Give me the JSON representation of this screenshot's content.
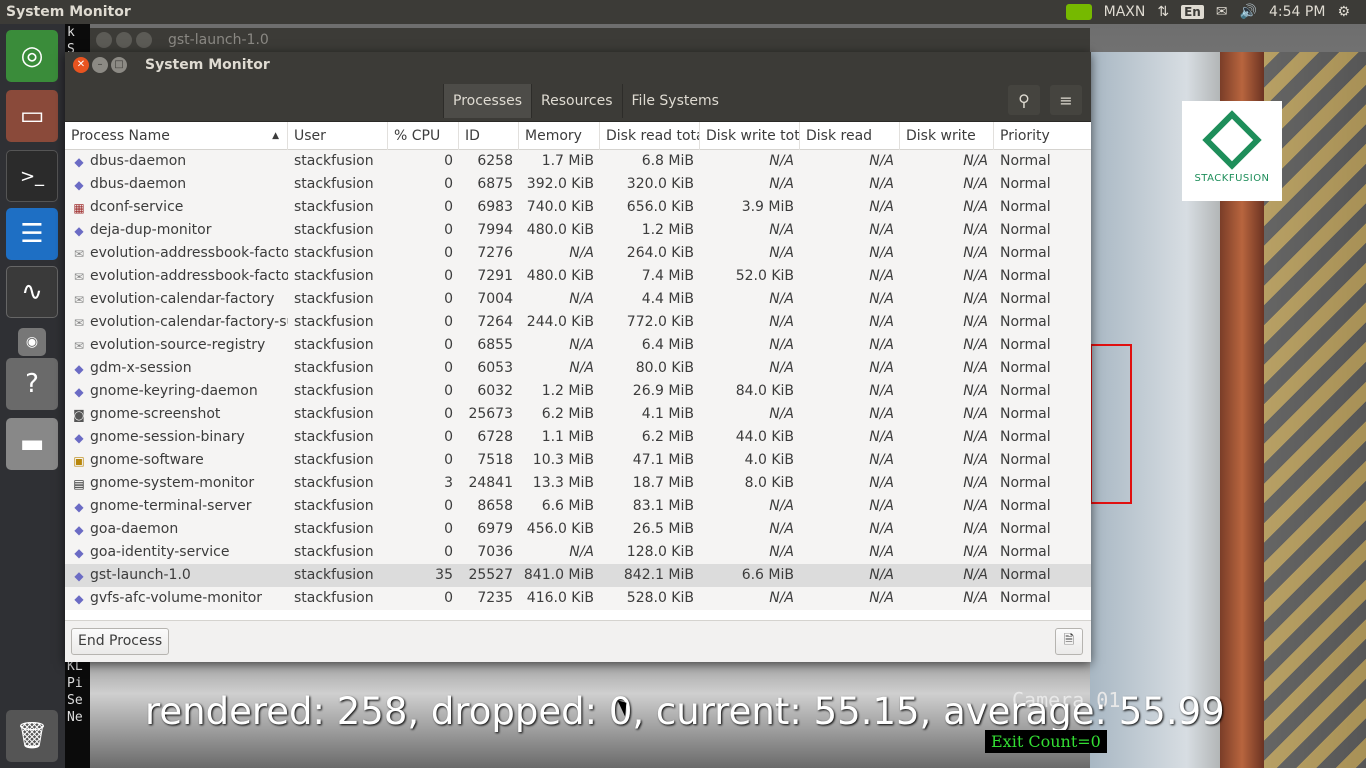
{
  "topbar": {
    "title": "System Monitor",
    "tray": {
      "power_mode": "MAXN",
      "keyboard": "En",
      "clock": "4:54 PM"
    }
  },
  "launcher": {
    "items": [
      "ubuntu-dash",
      "files",
      "terminal",
      "text-editor",
      "system-monitor",
      "screenshot",
      "help",
      "disks",
      "trash"
    ]
  },
  "background_terminal": {
    "lines_top": [
      "k",
      "S"
    ],
    "lines_bottom": [
      "KL",
      "Pi",
      "Se",
      "Ne"
    ]
  },
  "background_window": {
    "title": "gst-launch-1.0"
  },
  "video": {
    "osd_text": "rendered: 258, dropped: 0, current: 55.15, average: 55.99",
    "camera_label": "Camera 01",
    "exit_count": "Exit Count=0",
    "logo_text": "STACKFUSION"
  },
  "window": {
    "title": "System Monitor",
    "tabs": [
      {
        "label": "Processes",
        "active": true
      },
      {
        "label": "Resources",
        "active": false
      },
      {
        "label": "File Systems",
        "active": false
      }
    ],
    "columns": [
      "Process Name",
      "User",
      "% CPU",
      "ID",
      "Memory",
      "Disk read total",
      "Disk write total",
      "Disk read",
      "Disk write",
      "Priority"
    ],
    "rows": [
      {
        "icon": "diamond-icon",
        "name": "dbus-daemon",
        "user": "stackfusion",
        "cpu": "0",
        "id": "6258",
        "memory": "1.7 MiB",
        "disk_read_total": "6.8 MiB",
        "disk_write_total": "N/A",
        "disk_read": "N/A",
        "disk_write": "N/A",
        "priority": "Normal"
      },
      {
        "icon": "diamond-icon",
        "name": "dbus-daemon",
        "user": "stackfusion",
        "cpu": "0",
        "id": "6875",
        "memory": "392.0 KiB",
        "disk_read_total": "320.0 KiB",
        "disk_write_total": "N/A",
        "disk_read": "N/A",
        "disk_write": "N/A",
        "priority": "Normal"
      },
      {
        "icon": "dconf-icon",
        "name": "dconf-service",
        "user": "stackfusion",
        "cpu": "0",
        "id": "6983",
        "memory": "740.0 KiB",
        "disk_read_total": "656.0 KiB",
        "disk_write_total": "3.9 MiB",
        "disk_read": "N/A",
        "disk_write": "N/A",
        "priority": "Normal"
      },
      {
        "icon": "diamond-icon",
        "name": "deja-dup-monitor",
        "user": "stackfusion",
        "cpu": "0",
        "id": "7994",
        "memory": "480.0 KiB",
        "disk_read_total": "1.2 MiB",
        "disk_write_total": "N/A",
        "disk_read": "N/A",
        "disk_write": "N/A",
        "priority": "Normal"
      },
      {
        "icon": "envelope-icon",
        "name": "evolution-addressbook-factory",
        "user": "stackfusion",
        "cpu": "0",
        "id": "7276",
        "memory": "N/A",
        "disk_read_total": "264.0 KiB",
        "disk_write_total": "N/A",
        "disk_read": "N/A",
        "disk_write": "N/A",
        "priority": "Normal"
      },
      {
        "icon": "envelope-icon",
        "name": "evolution-addressbook-factory",
        "user": "stackfusion",
        "cpu": "0",
        "id": "7291",
        "memory": "480.0 KiB",
        "disk_read_total": "7.4 MiB",
        "disk_write_total": "52.0 KiB",
        "disk_read": "N/A",
        "disk_write": "N/A",
        "priority": "Normal"
      },
      {
        "icon": "envelope-icon",
        "name": "evolution-calendar-factory",
        "user": "stackfusion",
        "cpu": "0",
        "id": "7004",
        "memory": "N/A",
        "disk_read_total": "4.4 MiB",
        "disk_write_total": "N/A",
        "disk_read": "N/A",
        "disk_write": "N/A",
        "priority": "Normal"
      },
      {
        "icon": "envelope-icon",
        "name": "evolution-calendar-factory-subprocess",
        "user": "stackfusion",
        "cpu": "0",
        "id": "7264",
        "memory": "244.0 KiB",
        "disk_read_total": "772.0 KiB",
        "disk_write_total": "N/A",
        "disk_read": "N/A",
        "disk_write": "N/A",
        "priority": "Normal"
      },
      {
        "icon": "envelope-icon",
        "name": "evolution-source-registry",
        "user": "stackfusion",
        "cpu": "0",
        "id": "6855",
        "memory": "N/A",
        "disk_read_total": "6.4 MiB",
        "disk_write_total": "N/A",
        "disk_read": "N/A",
        "disk_write": "N/A",
        "priority": "Normal"
      },
      {
        "icon": "diamond-icon",
        "name": "gdm-x-session",
        "user": "stackfusion",
        "cpu": "0",
        "id": "6053",
        "memory": "N/A",
        "disk_read_total": "80.0 KiB",
        "disk_write_total": "N/A",
        "disk_read": "N/A",
        "disk_write": "N/A",
        "priority": "Normal"
      },
      {
        "icon": "diamond-icon",
        "name": "gnome-keyring-daemon",
        "user": "stackfusion",
        "cpu": "0",
        "id": "6032",
        "memory": "1.2 MiB",
        "disk_read_total": "26.9 MiB",
        "disk_write_total": "84.0 KiB",
        "disk_read": "N/A",
        "disk_write": "N/A",
        "priority": "Normal"
      },
      {
        "icon": "camera-icon",
        "name": "gnome-screenshot",
        "user": "stackfusion",
        "cpu": "0",
        "id": "25673",
        "memory": "6.2 MiB",
        "disk_read_total": "4.1 MiB",
        "disk_write_total": "N/A",
        "disk_read": "N/A",
        "disk_write": "N/A",
        "priority": "Normal"
      },
      {
        "icon": "diamond-icon",
        "name": "gnome-session-binary",
        "user": "stackfusion",
        "cpu": "0",
        "id": "6728",
        "memory": "1.1 MiB",
        "disk_read_total": "6.2 MiB",
        "disk_write_total": "44.0 KiB",
        "disk_read": "N/A",
        "disk_write": "N/A",
        "priority": "Normal"
      },
      {
        "icon": "bag-icon",
        "name": "gnome-software",
        "user": "stackfusion",
        "cpu": "0",
        "id": "7518",
        "memory": "10.3 MiB",
        "disk_read_total": "47.1 MiB",
        "disk_write_total": "4.0 KiB",
        "disk_read": "N/A",
        "disk_write": "N/A",
        "priority": "Normal"
      },
      {
        "icon": "monitor-icon",
        "name": "gnome-system-monitor",
        "user": "stackfusion",
        "cpu": "3",
        "id": "24841",
        "memory": "13.3 MiB",
        "disk_read_total": "18.7 MiB",
        "disk_write_total": "8.0 KiB",
        "disk_read": "N/A",
        "disk_write": "N/A",
        "priority": "Normal"
      },
      {
        "icon": "diamond-icon",
        "name": "gnome-terminal-server",
        "user": "stackfusion",
        "cpu": "0",
        "id": "8658",
        "memory": "6.6 MiB",
        "disk_read_total": "83.1 MiB",
        "disk_write_total": "N/A",
        "disk_read": "N/A",
        "disk_write": "N/A",
        "priority": "Normal"
      },
      {
        "icon": "diamond-icon",
        "name": "goa-daemon",
        "user": "stackfusion",
        "cpu": "0",
        "id": "6979",
        "memory": "456.0 KiB",
        "disk_read_total": "26.5 MiB",
        "disk_write_total": "N/A",
        "disk_read": "N/A",
        "disk_write": "N/A",
        "priority": "Normal"
      },
      {
        "icon": "diamond-icon",
        "name": "goa-identity-service",
        "user": "stackfusion",
        "cpu": "0",
        "id": "7036",
        "memory": "N/A",
        "disk_read_total": "128.0 KiB",
        "disk_write_total": "N/A",
        "disk_read": "N/A",
        "disk_write": "N/A",
        "priority": "Normal"
      },
      {
        "icon": "diamond-icon",
        "name": "gst-launch-1.0",
        "user": "stackfusion",
        "cpu": "35",
        "id": "25527",
        "memory": "841.0 MiB",
        "disk_read_total": "842.1 MiB",
        "disk_write_total": "6.6 MiB",
        "disk_read": "N/A",
        "disk_write": "N/A",
        "priority": "Normal",
        "selected": true
      },
      {
        "icon": "diamond-icon",
        "name": "gvfs-afc-volume-monitor",
        "user": "stackfusion",
        "cpu": "0",
        "id": "7235",
        "memory": "416.0 KiB",
        "disk_read_total": "528.0 KiB",
        "disk_write_total": "N/A",
        "disk_read": "N/A",
        "disk_write": "N/A",
        "priority": "Normal"
      }
    ],
    "end_process_label": "End Process"
  }
}
